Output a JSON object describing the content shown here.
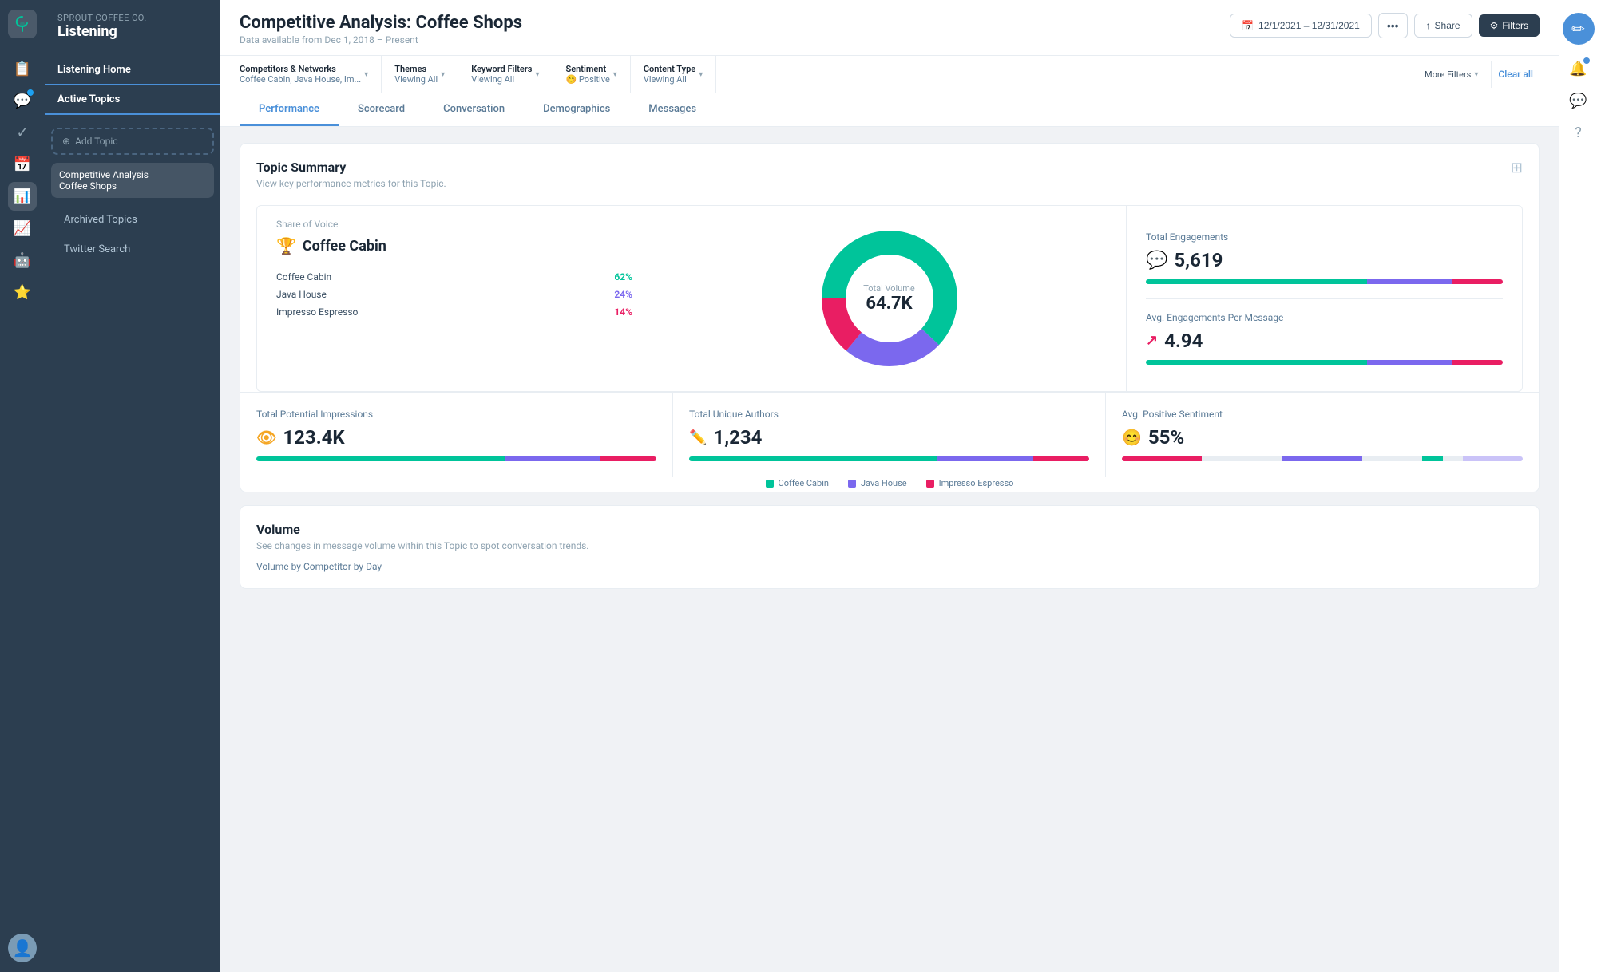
{
  "brand": {
    "company": "Sprout Coffee Co.",
    "product": "Listening"
  },
  "sidebar": {
    "listening_home": "Listening Home",
    "active_topics": "Active Topics",
    "add_topic": "Add Topic",
    "topics": [
      {
        "name": "Competitive Analysis\nCoffee Shops",
        "selected": true
      }
    ],
    "archived_topics": "Archived Topics",
    "twitter_search": "Twitter Search"
  },
  "header": {
    "title": "Competitive Analysis: Coffee Shops",
    "subtitle": "Data available from Dec 1, 2018 – Present",
    "date_range": "12/1/2021 – 12/31/2021",
    "share": "Share",
    "filters": "Filters"
  },
  "filter_bar": {
    "competitors": {
      "label": "Competitors & Networks",
      "value": "Coffee Cabin, Java House, Im..."
    },
    "themes": {
      "label": "Themes",
      "value": "Viewing All"
    },
    "keyword_filters": {
      "label": "Keyword Filters",
      "value": "Viewing All"
    },
    "sentiment": {
      "label": "Sentiment",
      "value": "😊 Positive"
    },
    "content_type": {
      "label": "Content Type",
      "value": "Viewing All"
    },
    "more_filters": "More Filters",
    "clear_all": "Clear all"
  },
  "tabs": [
    {
      "label": "Performance",
      "active": true
    },
    {
      "label": "Scorecard",
      "active": false
    },
    {
      "label": "Conversation",
      "active": false
    },
    {
      "label": "Demographics",
      "active": false
    },
    {
      "label": "Messages",
      "active": false
    }
  ],
  "topic_summary": {
    "title": "Topic Summary",
    "subtitle": "View key performance metrics for this Topic.",
    "share_of_voice": {
      "label": "Share of Voice",
      "winner": "Coffee Cabin",
      "competitors": [
        {
          "name": "Coffee Cabin",
          "pct": "62%",
          "color": "green"
        },
        {
          "name": "Java House",
          "pct": "24%",
          "color": "purple"
        },
        {
          "name": "Impresso Espresso",
          "pct": "14%",
          "color": "red"
        }
      ]
    },
    "donut": {
      "center_label": "Total Volume",
      "center_value": "64.7K",
      "segments": [
        {
          "label": "Coffee Cabin",
          "pct": 62,
          "color": "#00c49a"
        },
        {
          "label": "Java House",
          "pct": 24,
          "color": "#7b68ee"
        },
        {
          "label": "Impresso Espresso",
          "pct": 14,
          "color": "#e91e63"
        }
      ]
    },
    "total_engagements": {
      "label": "Total Engagements",
      "value": "5,619",
      "bar": [
        62,
        24,
        14
      ]
    },
    "avg_engagements": {
      "label": "Avg. Engagements Per Message",
      "value": "4.94",
      "bar": [
        62,
        24,
        14
      ]
    },
    "total_impressions": {
      "label": "Total Potential Impressions",
      "value": "123.4K"
    },
    "unique_authors": {
      "label": "Total Unique Authors",
      "value": "1,234"
    },
    "avg_sentiment": {
      "label": "Avg. Positive Sentiment",
      "value": "55%"
    }
  },
  "legend": [
    {
      "label": "Coffee Cabin",
      "color": "green"
    },
    {
      "label": "Java House",
      "color": "purple"
    },
    {
      "label": "Impresso Espresso",
      "color": "red"
    }
  ],
  "volume": {
    "title": "Volume",
    "subtitle": "See changes in message volume within this Topic to spot conversation trends.",
    "byline": "Volume by Competitor by Day"
  }
}
